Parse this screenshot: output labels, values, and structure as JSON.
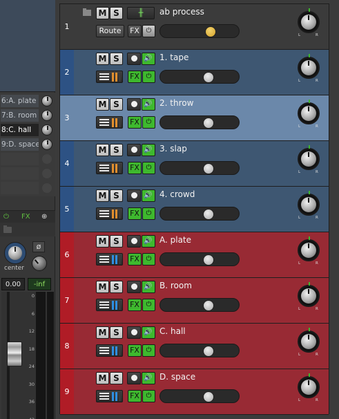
{
  "left_panel": {
    "sends": [
      {
        "label": "6:A. plate",
        "selected": false
      },
      {
        "label": "7:B. room",
        "selected": false
      },
      {
        "label": "8:C. hall",
        "selected": true
      },
      {
        "label": "9:D. space",
        "selected": false
      }
    ],
    "fx_label": "FX",
    "pan_label": "center",
    "phase_symbol": "ø",
    "volume_value": "0.00",
    "peak_value": "-inf",
    "scale_ticks": [
      "0",
      "6",
      "12",
      "18",
      "24",
      "30",
      "36",
      "42"
    ]
  },
  "tracks": [
    {
      "number": "1",
      "name": "ab process",
      "color": "#3b3b3b",
      "numcolor": "#3b3b3b",
      "is_folder": true,
      "route_label": "Route",
      "fx_label": "FX",
      "power": "⏻",
      "tuner_glyph": "╫",
      "volume_fraction": 0.68
    },
    {
      "number": "2",
      "name": "1. tape",
      "color": "#3e5772",
      "numcolor": "#2d5284",
      "is_folder": false,
      "fx_label": "FX",
      "power": "⏻",
      "io_bar_color": "#e08e2e",
      "volume_fraction": 0.65
    },
    {
      "number": "3",
      "name": "2. throw",
      "color": "#6b88aa",
      "numcolor": "#6b88aa",
      "is_folder": false,
      "fx_label": "FX",
      "power": "⏻",
      "io_bar_color": "#e08e2e",
      "volume_fraction": 0.65
    },
    {
      "number": "4",
      "name": "3. slap",
      "color": "#3e5772",
      "numcolor": "#2d5284",
      "is_folder": false,
      "fx_label": "FX",
      "power": "⏻",
      "io_bar_color": "#e08e2e",
      "volume_fraction": 0.65
    },
    {
      "number": "5",
      "name": "4. crowd",
      "color": "#3e5772",
      "numcolor": "#2d5284",
      "is_folder": false,
      "fx_label": "FX",
      "power": "⏻",
      "io_bar_color": "#e08e2e",
      "volume_fraction": 0.65
    },
    {
      "number": "6",
      "name": "A. plate",
      "color": "#982a34",
      "numcolor": "#b01c26",
      "is_folder": false,
      "fx_label": "FX",
      "power": "⏻",
      "io_bar_color": "#2e8ee0",
      "volume_fraction": 0.65
    },
    {
      "number": "7",
      "name": "B. room",
      "color": "#982a34",
      "numcolor": "#b01c26",
      "is_folder": false,
      "fx_label": "FX",
      "power": "⏻",
      "io_bar_color": "#2e8ee0",
      "volume_fraction": 0.65
    },
    {
      "number": "8",
      "name": "C. hall",
      "color": "#982a34",
      "numcolor": "#b01c26",
      "is_folder": false,
      "fx_label": "FX",
      "power": "⏻",
      "io_bar_color": "#2e8ee0",
      "volume_fraction": 0.65
    },
    {
      "number": "9",
      "name": "D. space",
      "color": "#982a34",
      "numcolor": "#b01c26",
      "is_folder": false,
      "fx_label": "FX",
      "power": "⏻",
      "io_bar_color": "#2e8ee0",
      "volume_fraction": 0.65
    }
  ],
  "labels": {
    "mute": "M",
    "solo": "S",
    "pan_left": "L",
    "pan_right": "R"
  }
}
